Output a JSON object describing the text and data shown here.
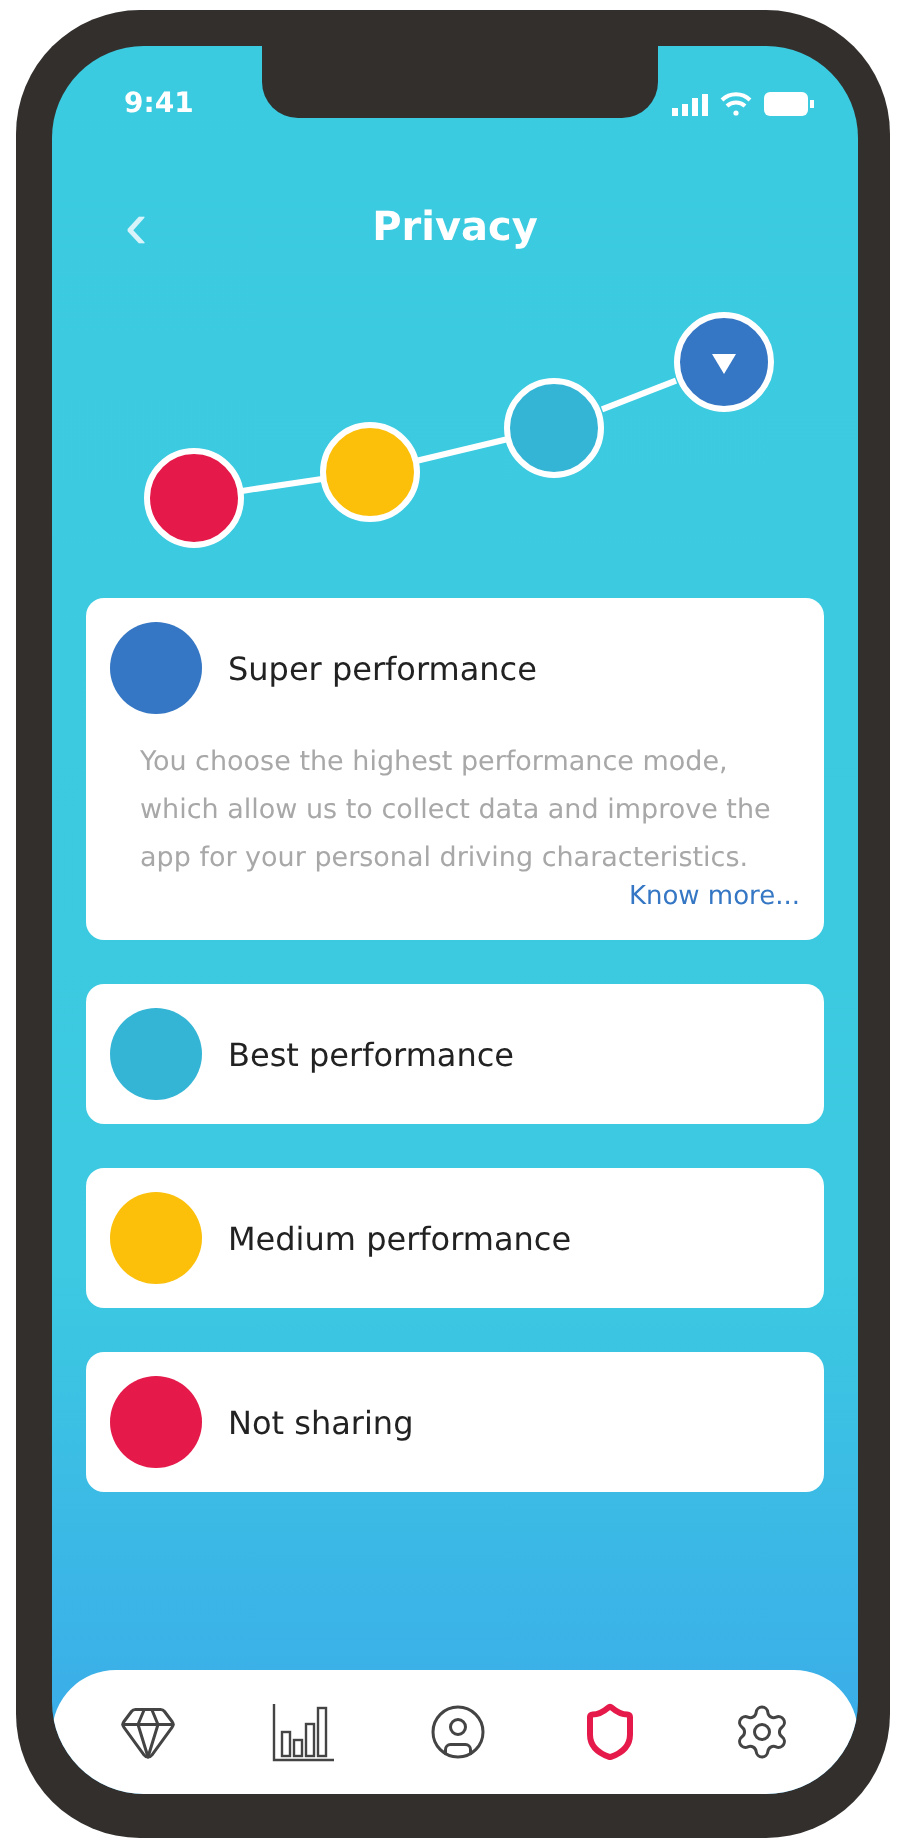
{
  "status_bar": {
    "time": "9:41"
  },
  "header": {
    "back": "‹",
    "title": "Privacy"
  },
  "levels": [
    {
      "color": "#e5194a",
      "selected": false
    },
    {
      "color": "#fcbf0a",
      "selected": false
    },
    {
      "color": "#35b5d6",
      "selected": false
    },
    {
      "color": "#3577c4",
      "selected": true
    }
  ],
  "options": [
    {
      "color": "#3577c4",
      "label": "Super performance",
      "expanded": true,
      "description": "You choose the highest performance mode, which allow us to collect data and improve the app for your personal driving characteristics.",
      "link": "Know more..."
    },
    {
      "color": "#35b5d6",
      "label": "Best performance",
      "expanded": false
    },
    {
      "color": "#fcbf0a",
      "label": "Medium performance",
      "expanded": false
    },
    {
      "color": "#e5194a",
      "label": "Not sharing",
      "expanded": false
    }
  ],
  "tab_bar": [
    {
      "kind": "gem",
      "selected": false
    },
    {
      "kind": "chart",
      "selected": false
    },
    {
      "kind": "profile",
      "selected": false
    },
    {
      "kind": "shield",
      "selected": true
    },
    {
      "kind": "settings",
      "selected": false
    }
  ]
}
